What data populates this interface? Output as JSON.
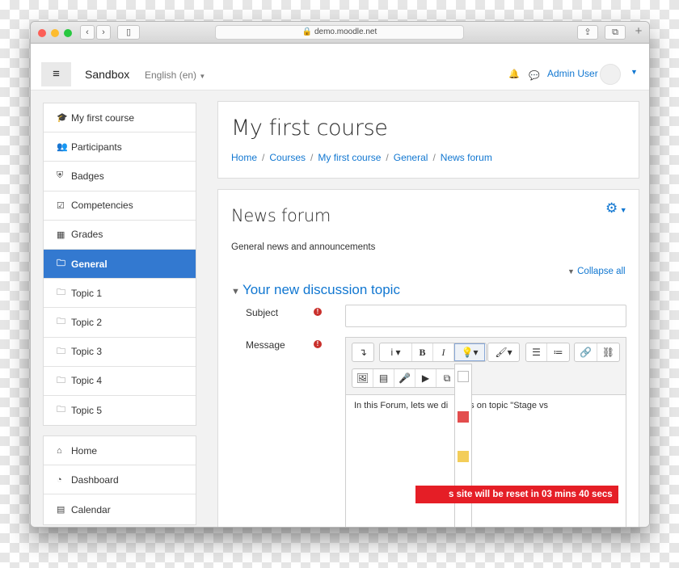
{
  "browser": {
    "url": "demo.moodle.net"
  },
  "topnav": {
    "menu_icon": "≡",
    "site_name": "Sandbox",
    "language": "English (en)",
    "user_name": "Admin User"
  },
  "sidebar": {
    "course_items": [
      {
        "label": "My first course",
        "icon": "graduation-cap-icon"
      },
      {
        "label": "Participants",
        "icon": "users-icon"
      },
      {
        "label": "Badges",
        "icon": "shield-icon"
      },
      {
        "label": "Competencies",
        "icon": "check-square-icon"
      },
      {
        "label": "Grades",
        "icon": "table-icon"
      },
      {
        "label": "General",
        "icon": "folder-icon",
        "active": true
      },
      {
        "label": "Topic 1",
        "icon": "folder-icon"
      },
      {
        "label": "Topic 2",
        "icon": "folder-icon"
      },
      {
        "label": "Topic 3",
        "icon": "folder-icon"
      },
      {
        "label": "Topic 4",
        "icon": "folder-icon"
      },
      {
        "label": "Topic 5",
        "icon": "folder-icon"
      }
    ],
    "site_items": [
      {
        "label": "Home",
        "icon": "home-icon"
      },
      {
        "label": "Dashboard",
        "icon": "dashboard-icon"
      },
      {
        "label": "Calendar",
        "icon": "calendar-icon"
      }
    ]
  },
  "header": {
    "title": "My first course",
    "breadcrumb": [
      "Home",
      "Courses",
      "My first course",
      "General",
      "News forum"
    ]
  },
  "forum": {
    "title": "News forum",
    "intro": "General news and announcements",
    "collapse_all": "Collapse all",
    "section_title": "Your new discussion topic",
    "subject_label": "Subject",
    "message_label": "Message",
    "subject_value": "",
    "message_text": "In this Forum, lets we di",
    "message_text_tail": "s on topic \"Stage vs"
  },
  "palette_colors": [
    "#ffffff",
    "#e34d4d",
    "#f3cd59",
    "#88bb4b"
  ],
  "banner": {
    "text": "s site will be reset in 03 mins 40 secs"
  },
  "colors": {
    "accent": "#1177d1",
    "active": "#3379d0",
    "warning": "#e51e26"
  }
}
